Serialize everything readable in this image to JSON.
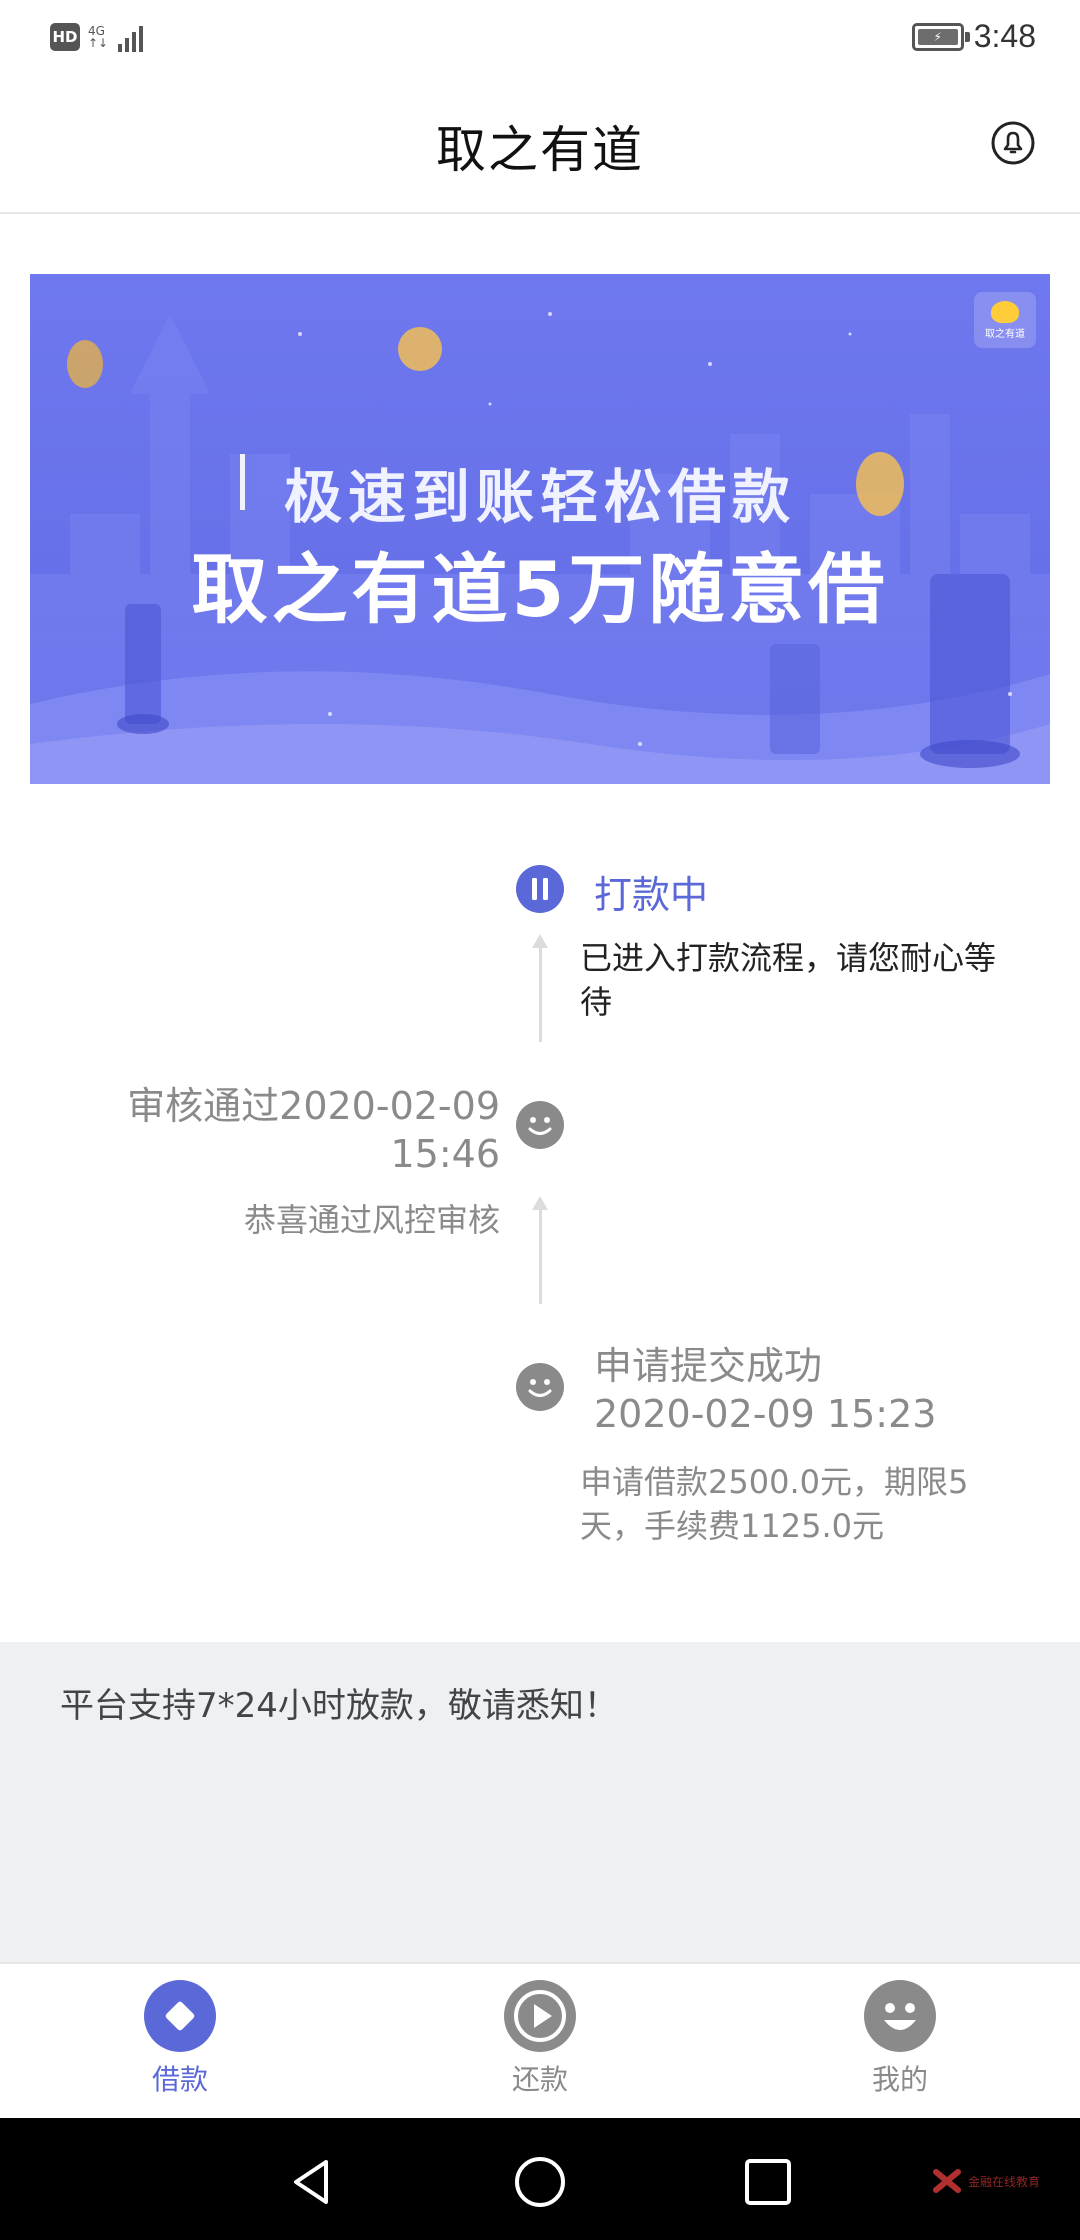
{
  "status_bar": {
    "hd": "HD",
    "network": "4G",
    "network_sub": "↑↓",
    "time": "3:48"
  },
  "header": {
    "title": "取之有道",
    "bell_icon": "bell-icon"
  },
  "banner": {
    "line1": "极速到账轻松借款",
    "line2": "取之有道5万随意借",
    "logo_text": "取之有道",
    "color": "#6a73eb"
  },
  "timeline": [
    {
      "state": "active",
      "icon": "pause-icon",
      "title": "打款中",
      "desc": "已进入打款流程，请您耐心等待"
    },
    {
      "state": "done",
      "icon": "smile-icon",
      "title": "审核通过2020-02-09 15:46",
      "desc": "恭喜通过风控审核"
    },
    {
      "state": "done",
      "icon": "smile-icon",
      "title": "申请提交成功2020-02-09 15:23",
      "desc": "申请借款2500.0元，期限5天，手续费1125.0元"
    }
  ],
  "timeline_display": {
    "t2_line1": "审核通过2020-02-09",
    "t2_line2": "15:46",
    "t3_line1": "申请提交成功",
    "t3_line2": "2020-02-09 15:23",
    "t1_desc_line1": "已进入打款流程，请您耐心等",
    "t1_desc_line2": "待",
    "t3_desc_line1": "申请借款2500.0元，期限5",
    "t3_desc_line2": "天，手续费1125.0元"
  },
  "notice": {
    "text": "平台支持7*24小时放款，敬请悉知！"
  },
  "bottom_nav": [
    {
      "label": "借款",
      "icon": "diamond-icon",
      "active": true
    },
    {
      "label": "还款",
      "icon": "play-icon",
      "active": false
    },
    {
      "label": "我的",
      "icon": "smile-icon",
      "active": false
    }
  ],
  "colors": {
    "accent": "#5b68d8",
    "gray": "#8a8a8a",
    "notice_bg": "#eef1f4"
  },
  "watermark": {
    "text": "金融在线教育"
  }
}
